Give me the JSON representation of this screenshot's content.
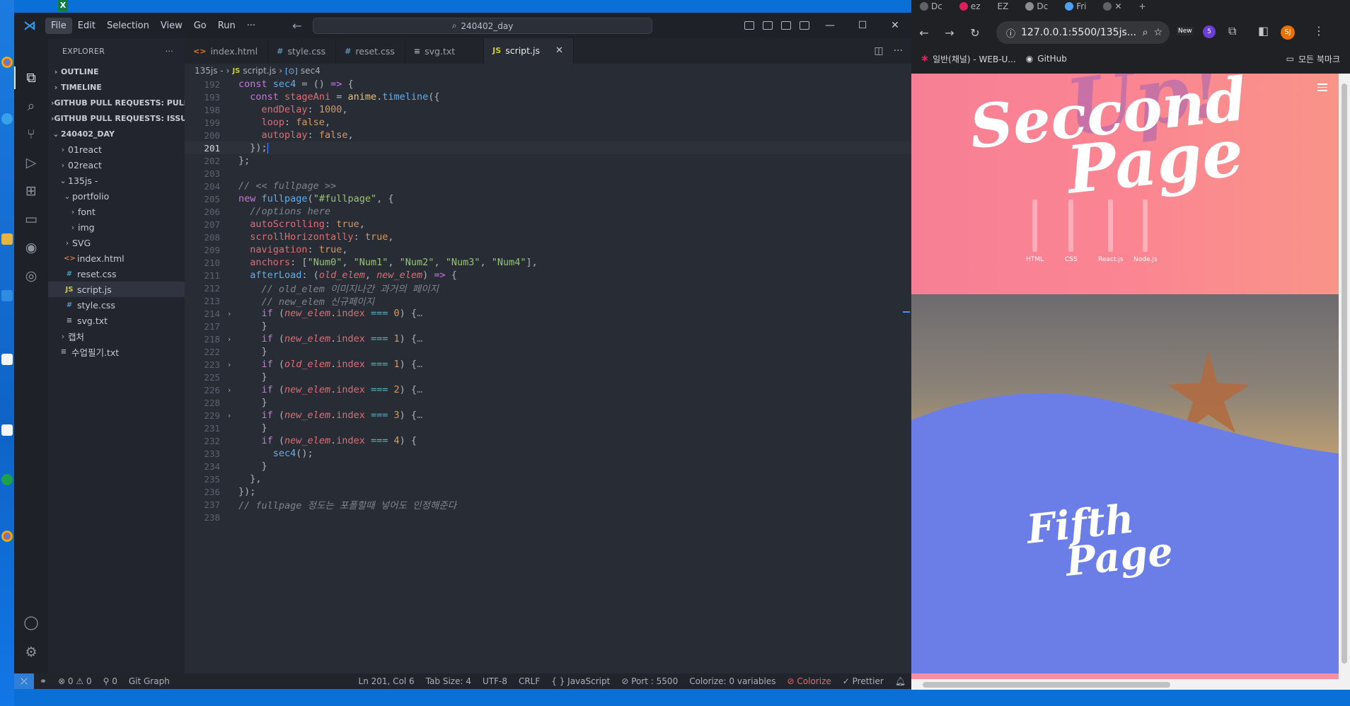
{
  "vscode": {
    "menu": [
      "File",
      "Edit",
      "Selection",
      "View",
      "Go",
      "Run",
      "···"
    ],
    "search_text": "240402_day",
    "explorer": {
      "title": "EXPLORER",
      "sections": [
        "OUTLINE",
        "TIMELINE",
        "GITHUB PULL REQUESTS: PULL ...",
        "GITHUB PULL REQUESTS: ISSUES",
        "240402_DAY"
      ],
      "tree": [
        "01react",
        "02react",
        "135js -",
        "portfolio",
        "font",
        "img",
        "SVG",
        "index.html",
        "reset.css",
        "script.js",
        "style.css",
        "svg.txt",
        "캡처",
        "수업필기.txt"
      ]
    },
    "tabs": [
      "index.html",
      "style.css",
      "reset.css",
      "svg.txt",
      "script.js"
    ],
    "tab_icons": [
      "<>",
      "#",
      "#",
      "≡",
      "JS"
    ],
    "breadcrumb": [
      "135js -",
      "script.js",
      "sec4"
    ],
    "line_numbers": [
      "192",
      "193",
      "198",
      "199",
      "200",
      "201",
      "202",
      "203",
      "204",
      "205",
      "206",
      "207",
      "208",
      "209",
      "210",
      "211",
      "212",
      "213",
      "214",
      "217",
      "218",
      "222",
      "223",
      "225",
      "226",
      "228",
      "229",
      "231",
      "232",
      "233",
      "234",
      "235",
      "236",
      "237",
      "238"
    ],
    "code_text": {
      "sec4_decl": "const sec4 = () => {",
      "timeline": "const stageAni = anime.timeline({",
      "endDelay": "endDelay: 1000,",
      "loop": "loop: false,",
      "autoplay": "autoplay: false,",
      "close1": "});",
      "close2": "};",
      "c_fullpage": "// << fullpage >>",
      "new_fullpage": "new fullpage(\"#fullpage\", {",
      "c_options": "//options here",
      "autoScrolling": "autoScrolling: true,",
      "scrollH": "scrollHorizontally: true,",
      "navigation": "navigation: true,",
      "anchors": "anchors: [\"Num0\", \"Num1\", \"Num2\", \"Num3\", \"Num4\"],",
      "afterLoad": "afterLoad: (old_elem, new_elem) => {",
      "c_old": "// old_elem 이미지나간 과거의 페이지",
      "c_new": "// new_elem 신규페이지",
      "if0": "if (new_elem.index === 0) {",
      "if1": "if (new_elem.index === 1) {",
      "if1old": "if (old_elem.index === 1) {",
      "if2": "if (new_elem.index === 2) {",
      "if3": "if (new_elem.index === 3) {",
      "if4": "if (new_elem.index === 4) {",
      "sec4call": "sec4();",
      "brace": "}",
      "brace_comma": "},",
      "final_close": "});",
      "c_end": "// fullpage 정도는 포폴할때 넣어도 인정해준다",
      "ellipsis": "…"
    },
    "status": {
      "problems": "⊗ 0 ⚠ 0",
      "ports": "⚲ 0",
      "git_graph": "Git Graph",
      "position": "Ln 201, Col 6",
      "tab_size": "Tab Size: 4",
      "encoding": "UTF-8",
      "eol": "CRLF",
      "language": "{ } JavaScript",
      "port": "⊘ Port : 5500",
      "colorize_vars": "Colorize: 0 variables",
      "colorize": "⊘ Colorize",
      "prettier": "✓ Prettier"
    }
  },
  "chrome": {
    "tabs": [
      "Dc",
      "ez",
      "EZ",
      "Dc",
      "Fri"
    ],
    "url": "127.0.0.1:5500/135js...",
    "new_badge": "New",
    "profile": "SJ",
    "ext_count": "5",
    "bookmarks": [
      "일반(채널) - WEB-U...",
      "GitHub"
    ],
    "bookmarks_right": "모든 북마크",
    "page": {
      "second_title_1": "Seccond",
      "second_title_2": "Page",
      "skills": [
        "HTML",
        "CSS",
        "React.js",
        "Node.js"
      ],
      "fifth_title_1": "Fifth",
      "fifth_title_2": "Page"
    }
  },
  "colors": {
    "editor_bg": "#282c34",
    "accent_blue": "#2f7fd9",
    "pink": "#f77f95",
    "wave_blue": "#6b7ee8"
  }
}
